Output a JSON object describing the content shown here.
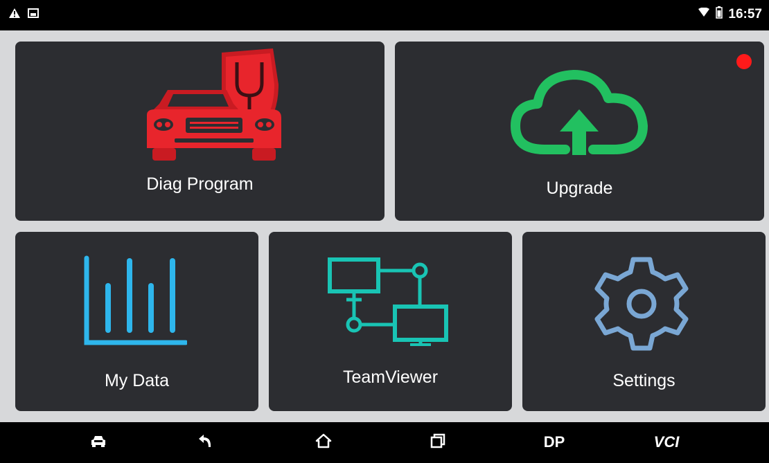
{
  "status_bar": {
    "time": "16:57",
    "left_icons": [
      "warning-icon",
      "image-icon"
    ],
    "right_icons": [
      "wifi-icon",
      "battery-icon"
    ]
  },
  "tiles": {
    "diag_program": {
      "label": "Diag Program",
      "icon": "car-diagnostic-icon",
      "color": "#e8252c"
    },
    "upgrade": {
      "label": "Upgrade",
      "icon": "cloud-upload-icon",
      "color": "#22c060",
      "has_notification": true
    },
    "my_data": {
      "label": "My Data",
      "icon": "bar-chart-icon",
      "color": "#2eb6ec"
    },
    "teamviewer": {
      "label": "TeamViewer",
      "icon": "network-icon",
      "color": "#19c4b4"
    },
    "settings": {
      "label": "Settings",
      "icon": "gear-icon",
      "color": "#7aa7d4"
    }
  },
  "nav_bar": {
    "dp_label": "DP",
    "vci_label": "VCI",
    "icons": [
      "car-icon",
      "back-icon",
      "home-icon",
      "recent-apps-icon"
    ]
  },
  "colors": {
    "background": "#d7d8da",
    "tile": "#2c2d31",
    "notification": "#ff1a1a"
  }
}
